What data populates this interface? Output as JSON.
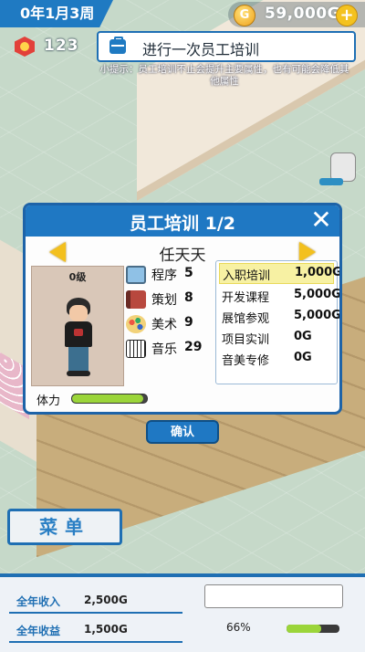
{
  "hud": {
    "date": "0年1月3周",
    "money": "59,000G",
    "plus_label": "+",
    "coin_symbol": "G",
    "level": "123"
  },
  "task": {
    "text": "进行一次员工培训",
    "tip": "小提示：员工培训不止会提升主要属性，也有可能会降低其他属性"
  },
  "dialog": {
    "title": "员工培训 1/2",
    "close_label": "✕",
    "employee_name": "任天天",
    "portrait_level": "0级",
    "skills": [
      {
        "label": "程序",
        "value": "5",
        "icon": "monitor-icon"
      },
      {
        "label": "策划",
        "value": "8",
        "icon": "book-icon"
      },
      {
        "label": "美术",
        "value": "9",
        "icon": "palette-icon"
      },
      {
        "label": "音乐",
        "value": "29",
        "icon": "piano-icon"
      }
    ],
    "courses": [
      {
        "name": "入职培训",
        "cost": "1,000G",
        "selected": true
      },
      {
        "name": "开发课程",
        "cost": "5,000G",
        "selected": false
      },
      {
        "name": "展馆参观",
        "cost": "5,000G",
        "selected": false
      },
      {
        "name": "项目实训",
        "cost": "0G",
        "selected": false
      },
      {
        "name": "音美专修",
        "cost": "0G",
        "selected": false
      }
    ],
    "stamina_label": "体力",
    "stamina_level": 0.95
  },
  "confirm_label": "确认",
  "menu_label": "菜单",
  "bottom": {
    "stats": [
      {
        "label": "全年收入",
        "value": "2,500G"
      },
      {
        "label": "全年收益",
        "value": "1,500G"
      }
    ],
    "percent": "66%",
    "progress": 0.66
  },
  "colors": {
    "brand_blue": "#1f78c3",
    "gold": "#f3c01e",
    "stamina_green": "#9bd53a"
  }
}
